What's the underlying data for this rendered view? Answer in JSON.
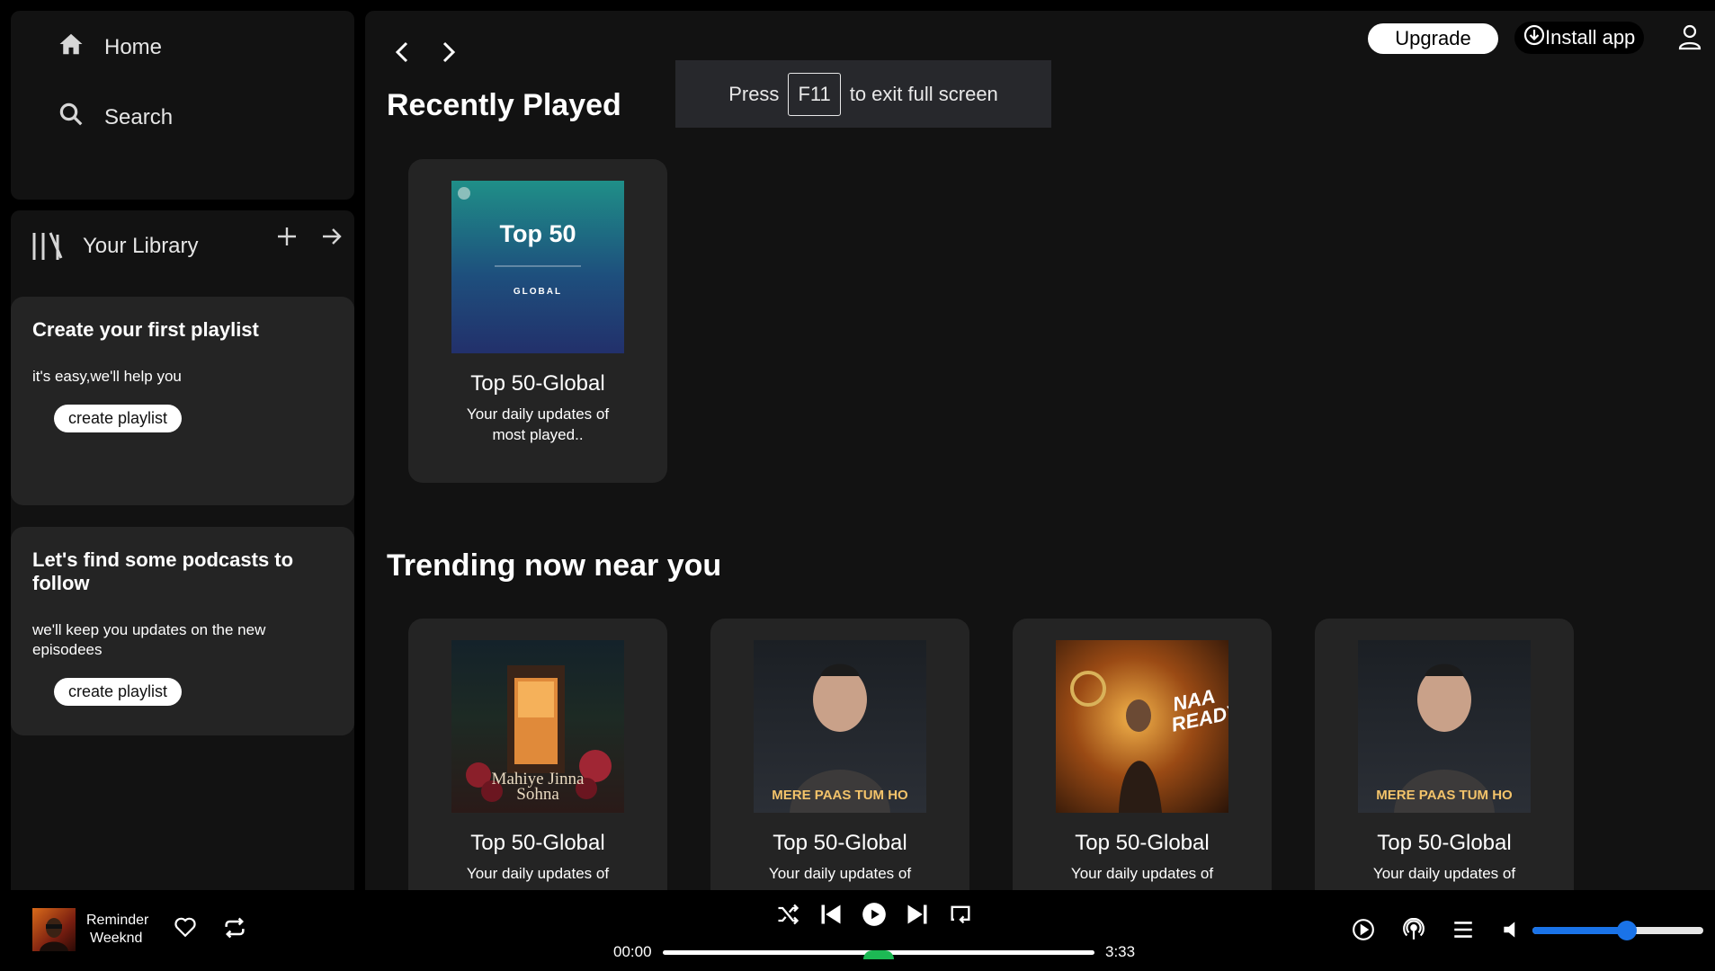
{
  "sidebar": {
    "nav": [
      {
        "label": "Home",
        "icon": "home-icon"
      },
      {
        "label": "Search",
        "icon": "search-icon"
      }
    ],
    "library": {
      "title": "Your Library",
      "cards": [
        {
          "title": "Create your first playlist",
          "text": "it's easy,we'll help you",
          "button": "create playlist"
        },
        {
          "title": "Let's find some podcasts to follow",
          "text": "we'll keep you updates on the new episodees",
          "button": "create playlist"
        }
      ]
    }
  },
  "header": {
    "upgrade": "Upgrade",
    "install": "Install app"
  },
  "fullscreen_toast": {
    "before": "Press",
    "key": "F11",
    "after": "to exit full screen"
  },
  "recently_played": {
    "title": "Recently Played",
    "items": [
      {
        "title": "Top 50-Global",
        "desc": "Your daily updates of most played..",
        "cover_title": "Top 50",
        "cover_sub": "GLOBAL"
      }
    ]
  },
  "trending": {
    "title": "Trending now near you",
    "items": [
      {
        "title": "Top 50-Global",
        "desc": "Your daily updates of",
        "cover_text": "Mahiye Jinna Sohna"
      },
      {
        "title": "Top 50-Global",
        "desc": "Your daily updates of",
        "cover_text": "MERE PAAS TUM HO"
      },
      {
        "title": "Top 50-Global",
        "desc": "Your daily updates of",
        "cover_text": "NAA READY"
      },
      {
        "title": "Top 50-Global",
        "desc": "Your daily updates of",
        "cover_text": "MERE PAAS TUM HO"
      }
    ]
  },
  "player": {
    "track_title": "Reminder",
    "track_artist": "Weeknd",
    "time_current": "00:00",
    "time_total": "3:33",
    "progress": 0.0,
    "volume": 0.55,
    "accent_color": "#1a73e8",
    "progress_color": "#1db954"
  }
}
